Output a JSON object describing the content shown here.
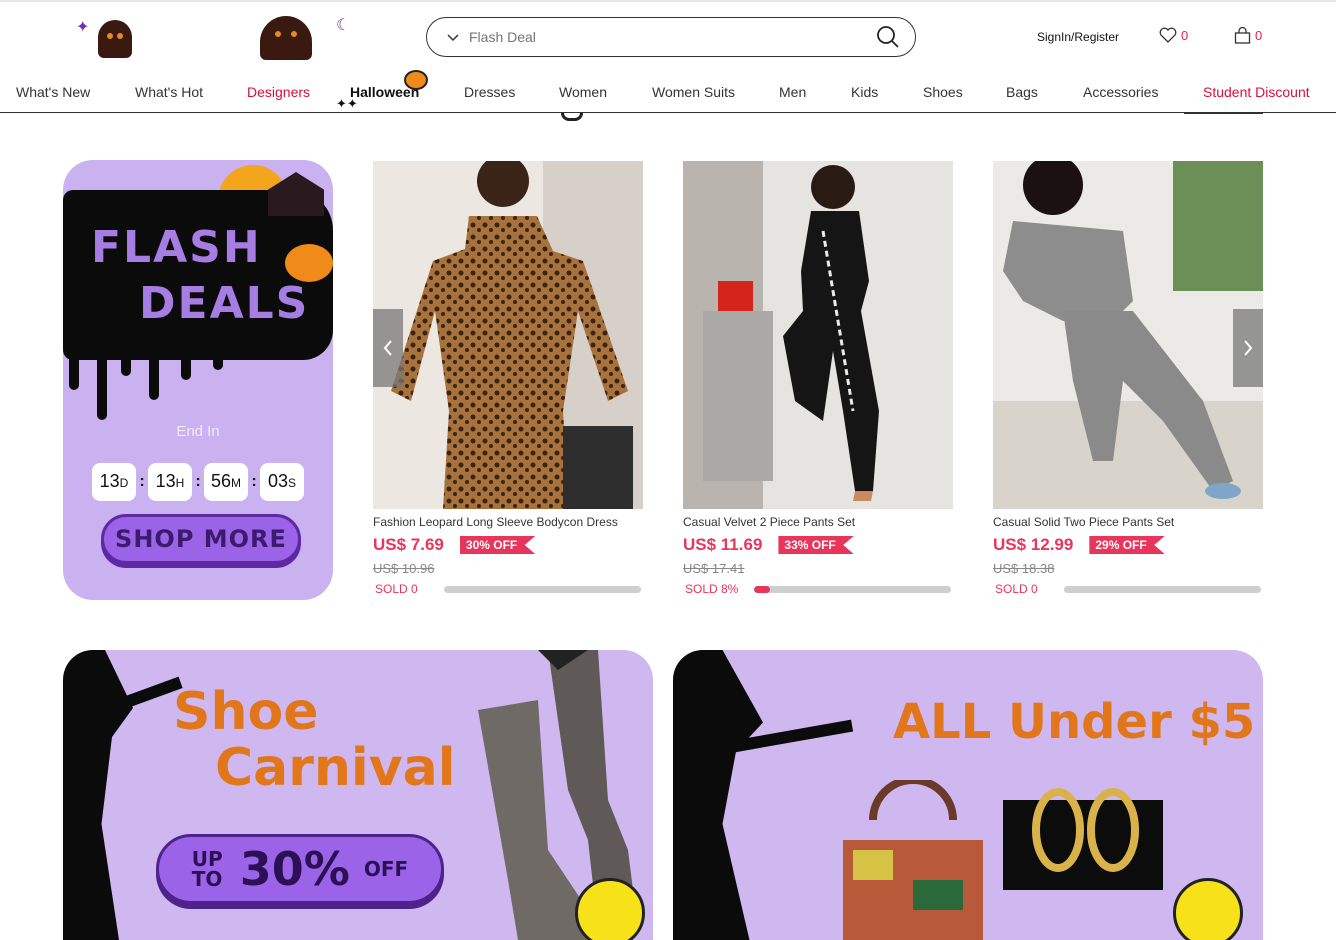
{
  "header": {
    "search_placeholder": "Flash Deal",
    "signin_label": "SignIn/Register",
    "wishlist_count": "0",
    "cart_count": "0"
  },
  "nav": {
    "items": [
      "What's New",
      "What's Hot",
      "Designers",
      "Halloween",
      "Dresses",
      "Women",
      "Women Suits",
      "Men",
      "Kids",
      "Shoes",
      "Bags",
      "Accessories",
      "Student Discount"
    ]
  },
  "flash": {
    "title_line1": "FLASH",
    "title_line2": "DEALS",
    "end_in_label": "End In",
    "timer": {
      "days": "13",
      "hours": "13",
      "minutes": "56",
      "seconds": "03",
      "d": "D",
      "h": "H",
      "m": "M",
      "s": "S"
    },
    "shop_more_label": "SHOP MORE"
  },
  "products": [
    {
      "name": "Fashion Leopard Long Sleeve Bodycon Dress",
      "price": "US$ 7.69",
      "discount": "30% OFF",
      "old_price": "US$ 10.96",
      "sold": "SOLD 0",
      "sold_pct": 0
    },
    {
      "name": "Casual Velvet 2 Piece Pants Set",
      "price": "US$ 11.69",
      "discount": "33% OFF",
      "old_price": "US$ 17.41",
      "sold": "SOLD 8%",
      "sold_pct": 8
    },
    {
      "name": "Casual Solid Two Piece Pants Set",
      "price": "US$ 12.99",
      "discount": "29% OFF",
      "old_price": "US$ 18.38",
      "sold": "SOLD 0",
      "sold_pct": 0
    }
  ],
  "banners": {
    "shoe": {
      "line1": "Shoe",
      "line2": "Carnival",
      "up": "UP",
      "to": "TO",
      "pct": "30%",
      "off": "OFF"
    },
    "under5": {
      "title": "ALL Under $5"
    }
  },
  "colors": {
    "accent": "#e8355c",
    "nav_red": "#d8103a",
    "halloween_purple": "#c9b2ef",
    "orange": "#e2761a"
  }
}
